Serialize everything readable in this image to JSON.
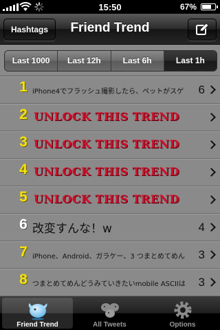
{
  "status": {
    "time": "15:50",
    "battery": "67%",
    "battery_level": 0.67
  },
  "nav": {
    "title": "Friend Trend",
    "left_button": "Hashtags",
    "right_button_icon": "compose-icon"
  },
  "segments": [
    {
      "label": "Last 1000",
      "selected": false
    },
    {
      "label": "Last 12h",
      "selected": false
    },
    {
      "label": "Last 6h",
      "selected": false
    },
    {
      "label": "Last 1h",
      "selected": true
    }
  ],
  "rows": [
    {
      "rank": "1",
      "text": "iPhone4でフラッシュ撮影したら、ペットがスゲ",
      "count": "6",
      "locked": false
    },
    {
      "rank": "2",
      "text": "UNLOCK THIS TREND",
      "count": "",
      "locked": true
    },
    {
      "rank": "3",
      "text": "UNLOCK THIS TREND",
      "count": "",
      "locked": true
    },
    {
      "rank": "4",
      "text": "UNLOCK THIS TREND",
      "count": "",
      "locked": true
    },
    {
      "rank": "5",
      "text": "UNLOCK THIS TREND",
      "count": "",
      "locked": true
    },
    {
      "rank": "6",
      "text": "改変すんな！w",
      "count": "4",
      "locked": false
    },
    {
      "rank": "7",
      "text": "iPhone、Android、ガラケー、3 つまとめてめん",
      "count": "3",
      "locked": false
    },
    {
      "rank": "8",
      "text": "つまとめてめんどうみていきたいmobile ASCIIは",
      "count": "3",
      "locked": false
    }
  ],
  "tabs": [
    {
      "label": "Friend Trend",
      "icon": "bird-icon",
      "selected": true
    },
    {
      "label": "All Tweets",
      "icon": "birds-icon",
      "selected": false
    },
    {
      "label": "Options",
      "icon": "gear-icon",
      "selected": false
    }
  ],
  "colors": {
    "rank_yellow": "#f4e20f",
    "unlock_red": "#d0102a",
    "row_bg": "#8a8a8a"
  }
}
